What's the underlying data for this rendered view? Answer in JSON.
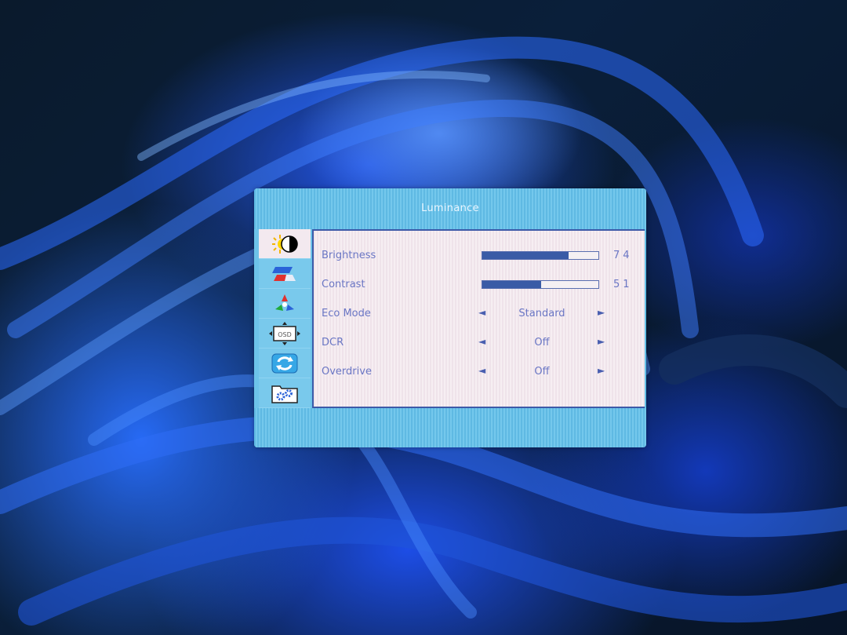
{
  "osd": {
    "title": "Luminance",
    "tabs": [
      {
        "name": "luminance",
        "icon": "brightness-contrast-icon",
        "active": true
      },
      {
        "name": "image-setup",
        "icon": "image-setup-icon",
        "active": false
      },
      {
        "name": "color-setup",
        "icon": "color-setup-icon",
        "active": false
      },
      {
        "name": "osd-setup",
        "icon": "osd-setup-icon",
        "active": false
      },
      {
        "name": "reset",
        "icon": "reset-icon",
        "active": false
      },
      {
        "name": "extra",
        "icon": "gears-icon",
        "active": false
      }
    ],
    "items": {
      "brightness": {
        "label": "Brightness",
        "value": 74,
        "value_text": "74"
      },
      "contrast": {
        "label": "Contrast",
        "value": 51,
        "value_text": "51"
      },
      "eco_mode": {
        "label": "Eco Mode",
        "value": "Standard"
      },
      "dcr": {
        "label": "DCR",
        "value": "Off"
      },
      "overdrive": {
        "label": "Overdrive",
        "value": "Off"
      }
    },
    "arrow_left": "◄",
    "arrow_right": "►"
  },
  "colors": {
    "panel": "#66c0e6",
    "content_bg": "#f3e9ef",
    "text": "#6a76c4",
    "slider_fill": "#3a5ba6"
  }
}
